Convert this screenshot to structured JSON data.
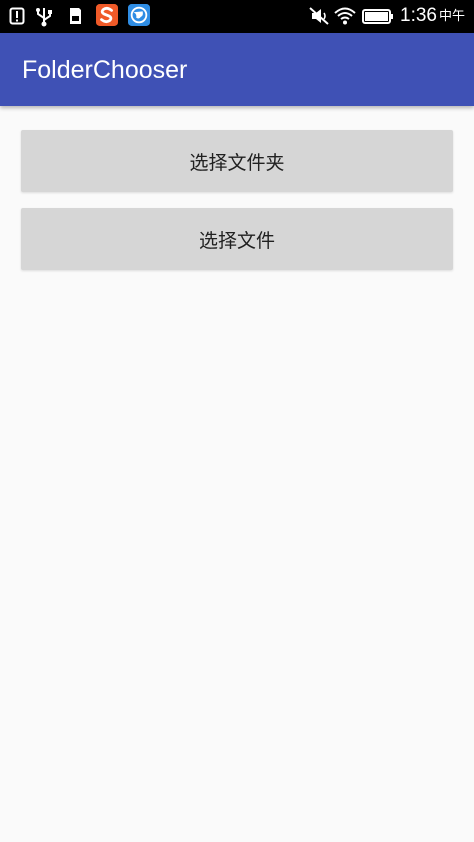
{
  "status_bar": {
    "time": "1:36",
    "period": "中午",
    "icons": [
      "alert-icon",
      "usb-icon",
      "sd-card-icon",
      "sogou-app-icon",
      "browser-app-icon",
      "mute-vibrate-icon",
      "wifi-icon",
      "battery-icon"
    ],
    "battery_level": 1.0
  },
  "app_bar": {
    "title": "FolderChooser",
    "color": "#3f51b5"
  },
  "main": {
    "choose_folder_label": "选择文件夹",
    "choose_file_label": "选择文件"
  }
}
